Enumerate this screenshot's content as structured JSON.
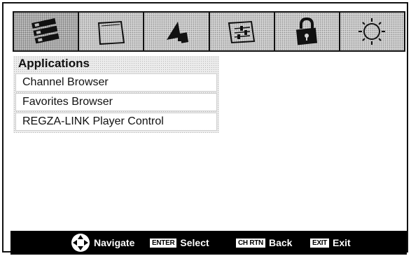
{
  "tabs": [
    {
      "icon": "applications-icon",
      "active": true
    },
    {
      "icon": "picture-icon",
      "active": false
    },
    {
      "icon": "sound-icon",
      "active": false
    },
    {
      "icon": "setup-icon",
      "active": false
    },
    {
      "icon": "lock-icon",
      "active": false
    },
    {
      "icon": "preferences-sun-icon",
      "active": false
    }
  ],
  "menu": {
    "title": "Applications",
    "items": [
      {
        "label": "Channel Browser"
      },
      {
        "label": "Favorites Browser"
      },
      {
        "label": "REGZA-LINK Player Control"
      }
    ]
  },
  "footer": {
    "navigate": {
      "label": "Navigate",
      "icon": "navigate-dpad-icon"
    },
    "select": {
      "key": "ENTER",
      "label": "Select"
    },
    "back": {
      "key": "CH RTN",
      "label": "Back"
    },
    "exit": {
      "key": "EXIT",
      "label": "Exit"
    }
  }
}
